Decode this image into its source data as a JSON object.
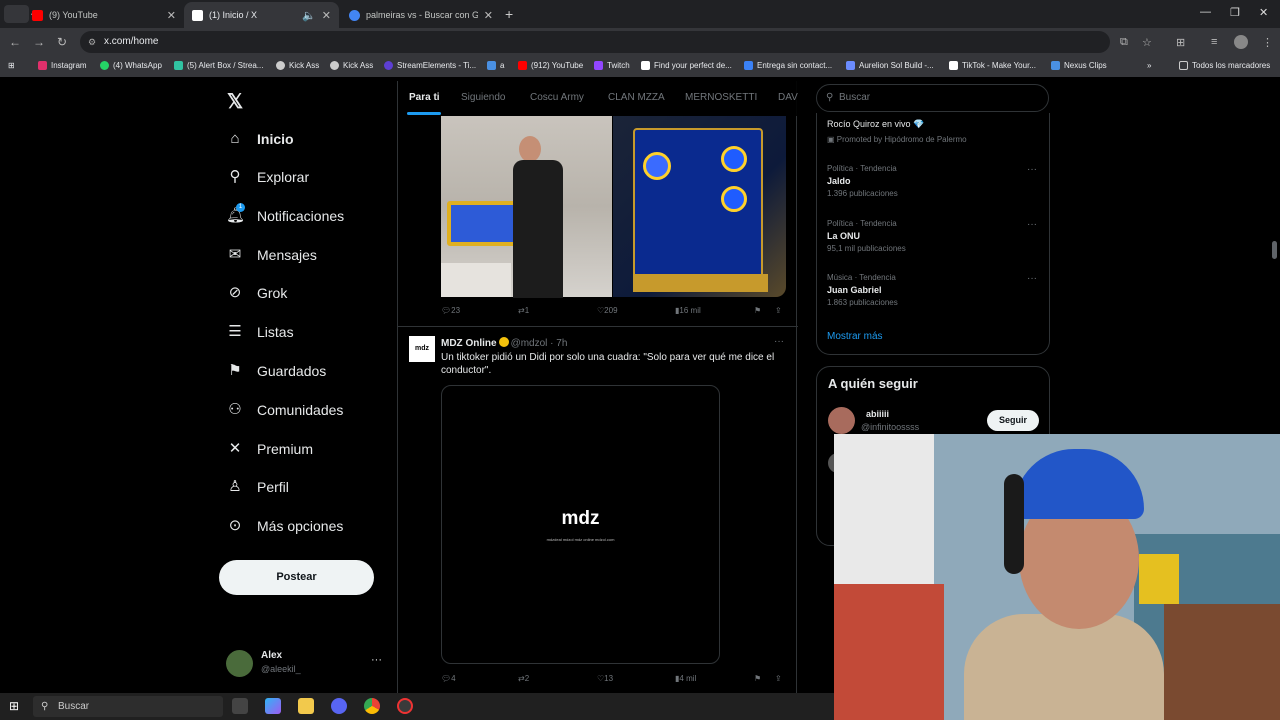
{
  "browser": {
    "tabs": [
      {
        "label": "(9) YouTube",
        "favicon_color": "#ff0000"
      },
      {
        "label": "(1) Inicio / X",
        "favicon_color": "#ffffff"
      },
      {
        "label": "palmeiras vs - Buscar con Google",
        "favicon_color": "#4285f4"
      }
    ],
    "new_tab": "+",
    "url": "x.com/home",
    "bookmarks": [
      {
        "label": "Instagram",
        "icon_color": "#e1306c"
      },
      {
        "label": "(4) WhatsApp",
        "icon_color": "#25d366"
      },
      {
        "label": "(5) Alert Box / Strea...",
        "icon_color": "#31c3a2"
      },
      {
        "label": "Kick Ass",
        "icon_color": "#cccccc"
      },
      {
        "label": "Kick Ass",
        "icon_color": "#cccccc"
      },
      {
        "label": "StreamElements - Ti...",
        "icon_color": "#5d3fd3"
      },
      {
        "label": "a",
        "icon_color": "#4a90e2"
      },
      {
        "label": "(912) YouTube",
        "icon_color": "#ff0000"
      },
      {
        "label": "Twitch",
        "icon_color": "#9146ff"
      },
      {
        "label": "Find your perfect de...",
        "icon_color": "#ffffff"
      },
      {
        "label": "Entrega sin contact...",
        "icon_color": "#3b82f6"
      },
      {
        "label": "Aurelion Sol Build -...",
        "icon_color": "#6b8cff"
      },
      {
        "label": "TikTok - Make Your...",
        "icon_color": "#ffffff"
      },
      {
        "label": "Nexus Clips",
        "icon_color": "#4a90e2"
      }
    ],
    "all_bookmarks": "Todos los marcadores"
  },
  "sidebar": {
    "items": [
      {
        "label": "Inicio",
        "icon": "home-icon"
      },
      {
        "label": "Explorar",
        "icon": "search-icon"
      },
      {
        "label": "Notificaciones",
        "icon": "bell-icon"
      },
      {
        "label": "Mensajes",
        "icon": "mail-icon"
      },
      {
        "label": "Grok",
        "icon": "grok-icon"
      },
      {
        "label": "Listas",
        "icon": "list-icon"
      },
      {
        "label": "Guardados",
        "icon": "bookmark-icon"
      },
      {
        "label": "Comunidades",
        "icon": "people-icon"
      },
      {
        "label": "Premium",
        "icon": "x-icon"
      },
      {
        "label": "Perfil",
        "icon": "person-icon"
      },
      {
        "label": "Más opciones",
        "icon": "more-circle-icon"
      }
    ],
    "notification_badge": "1",
    "post_button": "Postear",
    "profile": {
      "name": "Alex",
      "handle": "@aleekil_",
      "more": "···"
    }
  },
  "feed": {
    "tabs": [
      "Para ti",
      "Siguiendo",
      "Coscu Army",
      "CLAN MZZA",
      "MERNOSKETTI",
      "DAV"
    ],
    "tweet1": {
      "replies": "23",
      "retweets": "1",
      "likes": "209",
      "views": "16 mil"
    },
    "tweet2": {
      "author": "MDZ Online",
      "handle": "@mdzol",
      "time": "· 7h",
      "text": "Un tiktoker pidió un Didi por solo una cuadra: \"Solo para ver qué me dice el conductor\".",
      "avatar_text": "mdz",
      "video_logo": "mdz",
      "video_links": "mdzdeal   mdzol   mdz online   mdzol.com",
      "replies": "4",
      "retweets": "2",
      "likes": "13",
      "views": "4 mil",
      "more": "···"
    }
  },
  "rightbar": {
    "search_placeholder": "Buscar",
    "promo_title": "Rocío Quiroz en vivo 💎",
    "promo_sub": "Promoted by Hipódromo de Palermo",
    "trends": [
      {
        "category": "Política · Tendencia",
        "name": "Jaldo",
        "count": "1.396 publicaciones"
      },
      {
        "category": "Política · Tendencia",
        "name": "La ONU",
        "count": "95,1 mil publicaciones"
      },
      {
        "category": "Música · Tendencia",
        "name": "Juan Gabriel",
        "count": "1.863 publicaciones"
      }
    ],
    "trend_more": "···",
    "show_more": "Mostrar más",
    "who_to_follow": "A quién seguir",
    "follow": {
      "name": "abiiiii",
      "handle": "@infinitoossss",
      "button": "Seguir"
    }
  },
  "taskbar": {
    "search": "Buscar"
  }
}
